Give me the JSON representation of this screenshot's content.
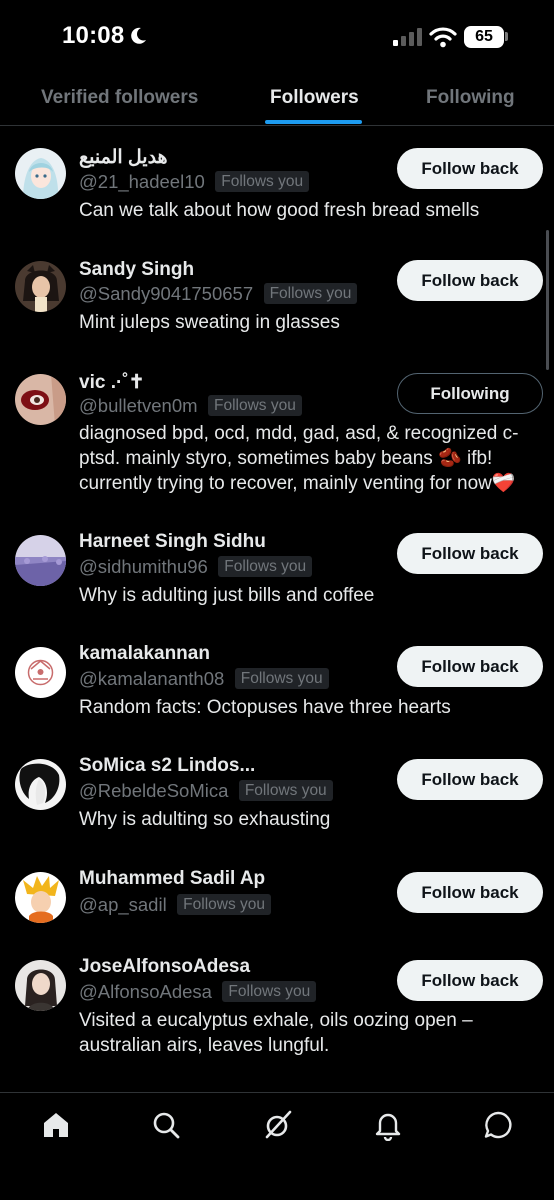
{
  "status_bar": {
    "time": "10:08",
    "battery": "65",
    "icons": [
      "moon-icon",
      "cellular-signal-icon",
      "wifi-icon",
      "battery-icon"
    ]
  },
  "tabs": [
    {
      "label": "Verified followers",
      "active": false
    },
    {
      "label": "Followers",
      "active": true
    },
    {
      "label": "Following",
      "active": false
    }
  ],
  "accent_color": "#1d9bf0",
  "followers": [
    {
      "name": "هديل المنيع",
      "handle": "@21_hadeel10",
      "badge": "Follows you",
      "bio": "Can we talk about how good fresh bread smells",
      "button": "Follow back"
    },
    {
      "name": "Sandy Singh",
      "handle": "@Sandy9041750657",
      "badge": "Follows you",
      "bio": "Mint juleps sweating in glasses",
      "button": "Follow back"
    },
    {
      "name": "vic .·˚✝",
      "handle": "@bulletven0m",
      "badge": "Follows you",
      "bio": "diagnosed bpd, ocd, mdd, gad, asd, & recognized c-ptsd. mainly styro, sometimes baby beans 🫘 ifb! currently trying to recover, mainly venting for now❤️‍🩹",
      "button": "Following"
    },
    {
      "name": "Harneet Singh Sidhu",
      "handle": "@sidhumithu96",
      "badge": "Follows you",
      "bio": "Why is adulting just bills and coffee",
      "button": "Follow back"
    },
    {
      "name": "kamalakannan",
      "handle": "@kamalananth08",
      "badge": "Follows you",
      "bio": "Random facts: Octopuses have three hearts",
      "button": "Follow back"
    },
    {
      "name": "SoMica s2 Lindos...",
      "handle": "@RebeldeSoMica",
      "badge": "Follows you",
      "bio": "Why is adulting so exhausting",
      "button": "Follow back"
    },
    {
      "name": "Muhammed Sadil Ap",
      "handle": "@ap_sadil",
      "badge": "Follows you",
      "bio": "",
      "button": "Follow back"
    },
    {
      "name": "JoseAlfonsoAdesa",
      "handle": "@AlfonsoAdesa",
      "badge": "Follows you",
      "bio": "Visited a eucalyptus exhale, oils oozing open – australian airs, leaves lungful.",
      "button": "Follow back"
    }
  ],
  "bottom_nav": [
    "home-icon",
    "search-icon",
    "grok-icon",
    "notifications-icon",
    "messages-icon"
  ]
}
